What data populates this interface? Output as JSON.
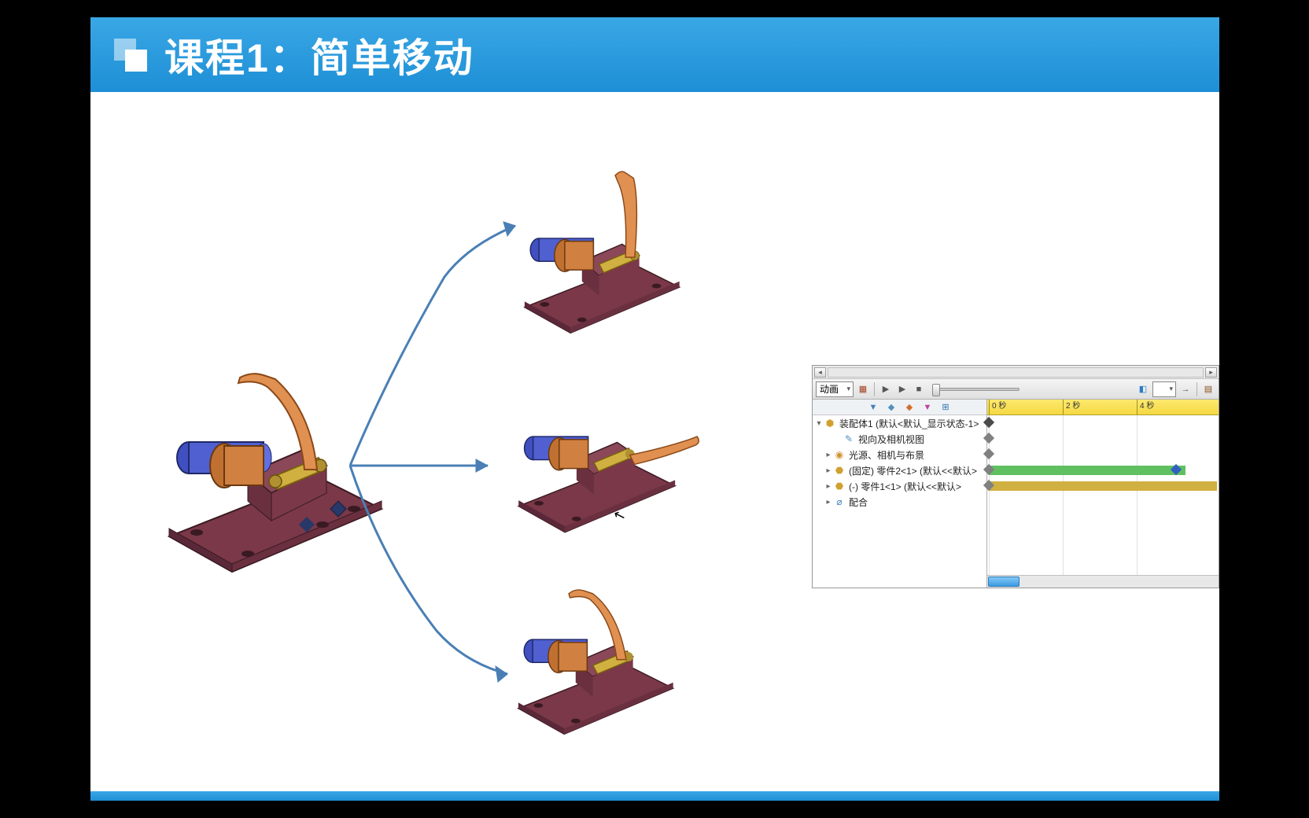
{
  "title": "课程1：简单移动",
  "timeline": {
    "mode_dropdown": "动画",
    "ruler_ticks": [
      "0 秒",
      "2 秒",
      "4 秒"
    ],
    "tree": {
      "root": "装配体1 (默认<默认_显示状态-1>",
      "items": [
        {
          "icon": "orientation-icon",
          "label": "视向及相机视图"
        },
        {
          "icon": "light-icon",
          "label": "光源、相机与布景",
          "expandable": true
        },
        {
          "icon": "part-icon",
          "label": "(固定) 零件2<1> (默认<<默认>",
          "expandable": true
        },
        {
          "icon": "part-icon",
          "label": "(-) 零件1<1> (默认<<默认>",
          "expandable": true
        },
        {
          "icon": "mate-icon",
          "label": "配合",
          "expandable": true
        }
      ]
    }
  }
}
